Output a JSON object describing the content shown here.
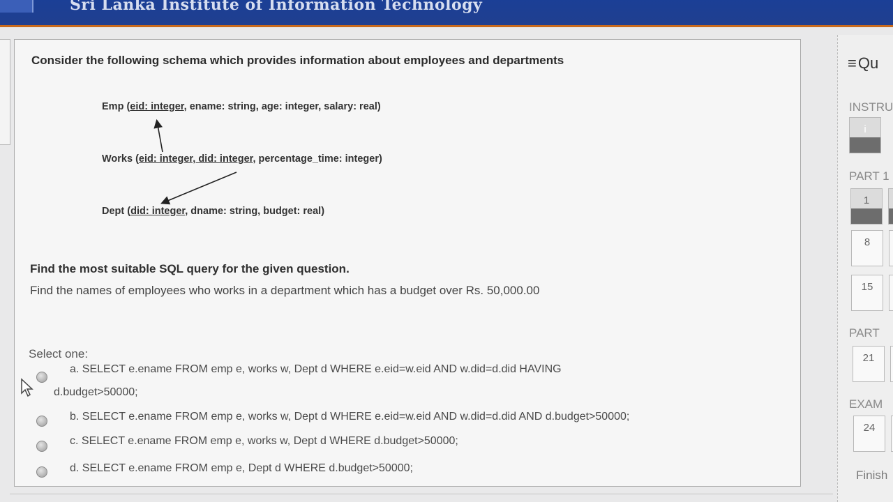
{
  "header": {
    "title": "Sri Lanka Institute of Information Technology"
  },
  "question": {
    "heading": "Consider the following schema which provides information about employees and departments",
    "schema": {
      "emp": {
        "prefix": "Emp (",
        "key": "eid: integer",
        "rest": ", ename: string, age: integer, salary: real)"
      },
      "works": {
        "prefix": "Works (",
        "key": "eid: integer, did: integer",
        "rest": ", percentage_time: integer)"
      },
      "dept": {
        "prefix": "Dept (",
        "key": "did: integer",
        "rest": ", dname: string, budget: real)"
      }
    },
    "label": "Find the most suitable SQL query for the given question.",
    "text": "Find the names of employees who works in a department which has a budget over Rs. 50,000.00",
    "select_one": "Select one:",
    "options": [
      {
        "line1": "a. SELECT e.ename FROM emp e, works w, Dept d WHERE e.eid=w.eid AND w.did=d.did HAVING",
        "line2": "d.budget>50000;"
      },
      {
        "line1": "b. SELECT e.ename FROM emp e, works w, Dept d WHERE e.eid=w.eid AND w.did=d.did AND d.budget>50000;"
      },
      {
        "line1": "c. SELECT e.ename FROM emp e, works w, Dept d WHERE d.budget>50000;"
      },
      {
        "line1": "d. SELECT e.ename FROM emp e, Dept d WHERE d.budget>50000;"
      }
    ]
  },
  "nav": {
    "title": "Qu",
    "sections": [
      "INSTRU",
      "PART 1",
      "PART",
      "EXAM"
    ],
    "buttons": {
      "instructions": [
        "i"
      ],
      "part1": [
        "1",
        "",
        "8",
        "",
        "15",
        ""
      ],
      "part2": [
        "21",
        ""
      ],
      "exam": [
        "24",
        ""
      ]
    },
    "finish": "Finish"
  },
  "colors": {
    "header": "#1f3f92",
    "accent": "#c96a1c"
  }
}
